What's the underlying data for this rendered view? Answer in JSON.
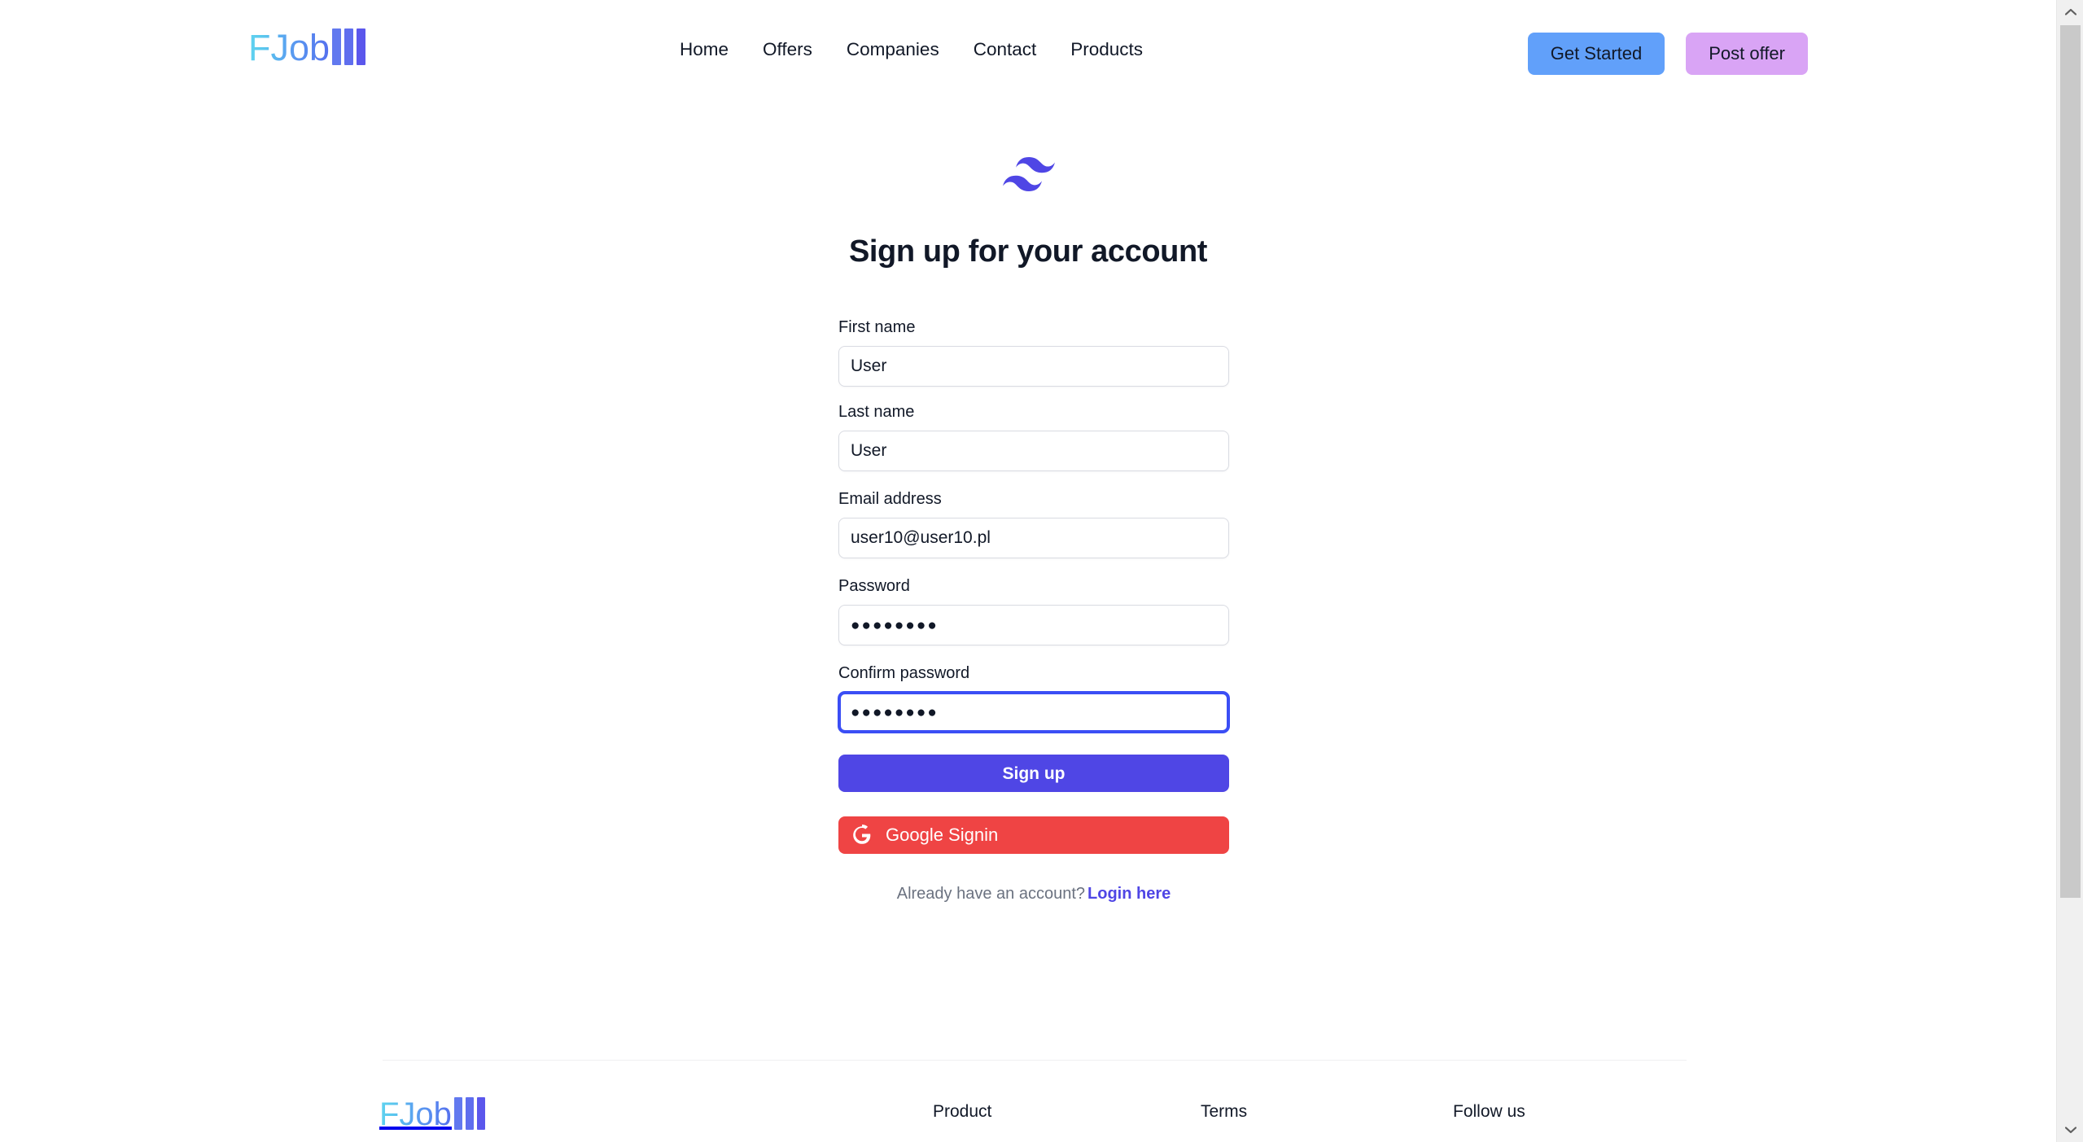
{
  "brand": {
    "name": "FJob",
    "bars_icon": "three-bars-icon"
  },
  "header": {
    "nav": [
      {
        "label": "Home"
      },
      {
        "label": "Offers"
      },
      {
        "label": "Companies"
      },
      {
        "label": "Contact"
      },
      {
        "label": "Products"
      }
    ],
    "get_started_label": "Get Started",
    "post_offer_label": "Post offer",
    "get_started_color": "#61a0fa",
    "post_offer_color": "#d9a4f5"
  },
  "signup": {
    "logo_icon": "tailwind-wave-logo-icon",
    "logo_color": "#4f46e5",
    "title": "Sign up for your account",
    "fields": {
      "first_name": {
        "label": "First name",
        "value": "User",
        "placeholder": ""
      },
      "last_name": {
        "label": "Last name",
        "value": "User",
        "placeholder": ""
      },
      "email": {
        "label": "Email address",
        "value": "user10@user10.pl",
        "placeholder": ""
      },
      "password": {
        "label": "Password",
        "value": "●●●●●●●●",
        "placeholder": ""
      },
      "confirm_password": {
        "label": "Confirm password",
        "value": "●●●●●●●●",
        "placeholder": "",
        "focused": true
      }
    },
    "submit_label": "Sign up",
    "submit_color": "#4f46e5",
    "google_label": "Google Signin",
    "google_color": "#ef4444",
    "google_icon": "google-g-icon",
    "login_prompt": "Already have an account?",
    "login_link_label": "Login here",
    "login_link_color": "#4f46e5",
    "focus_ring_color": "#3b4ef5"
  },
  "footer": {
    "brand_name": "FJob",
    "columns": [
      {
        "title": "Product"
      },
      {
        "title": "Terms"
      },
      {
        "title": "Follow us"
      }
    ]
  },
  "scrollbar": {
    "up_icon": "chevron-up-icon",
    "down_icon": "chevron-down-icon"
  }
}
